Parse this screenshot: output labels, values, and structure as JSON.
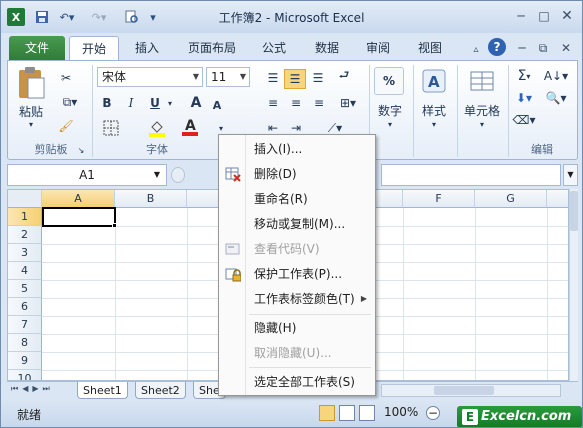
{
  "window": {
    "title": "工作簿2 - Microsoft Excel"
  },
  "ribbon_tabs": [
    "文件",
    "开始",
    "插入",
    "页面布局",
    "公式",
    "数据",
    "审阅",
    "视图"
  ],
  "ribbon": {
    "clipboard": {
      "paste_label": "粘贴",
      "group_label": "剪贴板"
    },
    "font": {
      "font_name": "宋体",
      "font_size": "11",
      "bold": "B",
      "italic": "I",
      "underline": "U",
      "grow": "A",
      "shrink": "A",
      "group_label": "字体"
    },
    "number": {
      "label": "数字",
      "percent": "%"
    },
    "styles": {
      "label": "样式"
    },
    "cells": {
      "label": "单元格"
    },
    "editing": {
      "label": "编辑",
      "sigma": "Σ"
    }
  },
  "formula_bar": {
    "name_box": "A1"
  },
  "grid": {
    "columns": [
      "A",
      "B",
      "C",
      "D",
      "E",
      "F",
      "G"
    ],
    "rows": [
      "1",
      "2",
      "3",
      "4",
      "5",
      "6",
      "7",
      "8",
      "9",
      "10"
    ],
    "selected_cell": "A1"
  },
  "sheet_tabs": [
    "Sheet1",
    "Sheet2",
    "She"
  ],
  "context_menu": {
    "items": [
      {
        "label": "插入(I)...",
        "enabled": true,
        "icon": "none"
      },
      {
        "label": "删除(D)",
        "enabled": true,
        "icon": "delete-sheet-icon"
      },
      {
        "label": "重命名(R)",
        "enabled": true,
        "icon": "none"
      },
      {
        "label": "移动或复制(M)...",
        "enabled": true,
        "icon": "none"
      },
      {
        "label": "查看代码(V)",
        "enabled": false,
        "icon": "view-code-icon"
      },
      {
        "label": "保护工作表(P)...",
        "enabled": true,
        "icon": "protect-sheet-icon"
      },
      {
        "label": "工作表标签颜色(T)",
        "enabled": true,
        "icon": "none",
        "submenu": true
      },
      {
        "label": "隐藏(H)",
        "enabled": true,
        "icon": "none"
      },
      {
        "label": "取消隐藏(U)...",
        "enabled": false,
        "icon": "none"
      },
      {
        "label": "选定全部工作表(S)",
        "enabled": true,
        "icon": "none"
      }
    ]
  },
  "status": {
    "ready": "就绪",
    "zoom": "100%"
  },
  "watermark": "Excelcn.com",
  "colors": {
    "file_tab": "#2f7c37",
    "selection": "#000000",
    "header_highlight": "#f8d47d"
  }
}
